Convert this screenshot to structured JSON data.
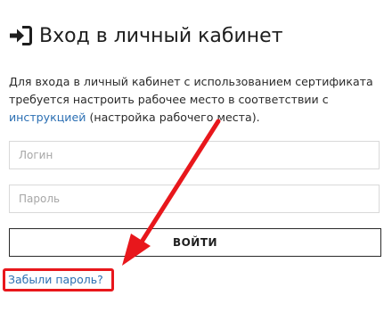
{
  "header": {
    "title": "Вход в личный кабинет",
    "icon": "login-icon"
  },
  "description": {
    "text_before": "Для входа в личный кабинет с использованием сертификата требуется настроить рабочее место в соответствии с ",
    "link_text": "инструкцией",
    "text_after": " (настройка рабочего места)."
  },
  "form": {
    "login_placeholder": "Логин",
    "password_placeholder": "Пароль",
    "submit_label": "ВОЙТИ",
    "forgot_label": "Забыли пароль?"
  },
  "annotation": {
    "color": "#e8171c",
    "link_color": "#2b6fb3"
  }
}
